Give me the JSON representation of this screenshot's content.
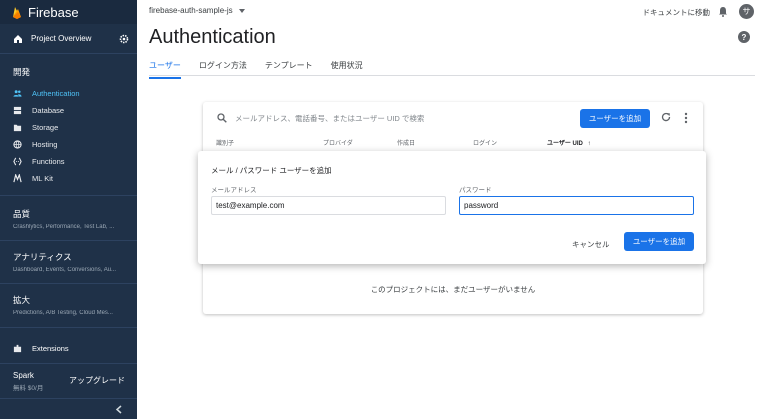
{
  "app": {
    "title": "Firebase"
  },
  "sidebar": {
    "overview": "Project Overview",
    "section_develop": "開発",
    "items": [
      {
        "label": "Authentication",
        "icon": "people-icon",
        "active": true
      },
      {
        "label": "Database",
        "icon": "database-icon"
      },
      {
        "label": "Storage",
        "icon": "storage-icon"
      },
      {
        "label": "Hosting",
        "icon": "globe-icon"
      },
      {
        "label": "Functions",
        "icon": "functions-icon"
      },
      {
        "label": "ML Kit",
        "icon": "mlkit-icon"
      }
    ],
    "groups": [
      {
        "title": "品質",
        "subtitle": "Crashlytics, Performance, Test Lab, ..."
      },
      {
        "title": "アナリティクス",
        "subtitle": "Dashboard, Events, Conversions, Au..."
      },
      {
        "title": "拡大",
        "subtitle": "Predictions, A/B Testing, Cloud Mes..."
      }
    ],
    "extensions": "Extensions",
    "plan": {
      "name": "Spark",
      "price": "無料 $0/月",
      "upgrade": "アップグレード"
    }
  },
  "header": {
    "project": "firebase-auth-sample-js",
    "docs_link": "ドキュメントに移動",
    "avatar_letter": "サ",
    "page_title": "Authentication"
  },
  "tabs": [
    "ユーザー",
    "ログイン方法",
    "テンプレート",
    "使用状況"
  ],
  "users_card": {
    "search_placeholder": "メールアドレス、電話番号、またはユーザー UID で検索",
    "add_user": "ユーザーを追加",
    "columns": [
      "識別子",
      "プロバイダ",
      "作成日",
      "ログイン",
      "ユーザー UID"
    ],
    "empty_message": "このプロジェクトには、まだユーザーがいません"
  },
  "dialog": {
    "title": "メール / パスワード ユーザーを追加",
    "email_label": "メールアドレス",
    "email_value": "test@example.com",
    "password_label": "パスワード",
    "password_value": "password",
    "cancel": "キャンセル",
    "submit": "ユーザーを追加"
  },
  "colors": {
    "sidebar_bg": "#1f3148",
    "accent": "#1a73e8",
    "active_item": "#4fc3f7"
  }
}
